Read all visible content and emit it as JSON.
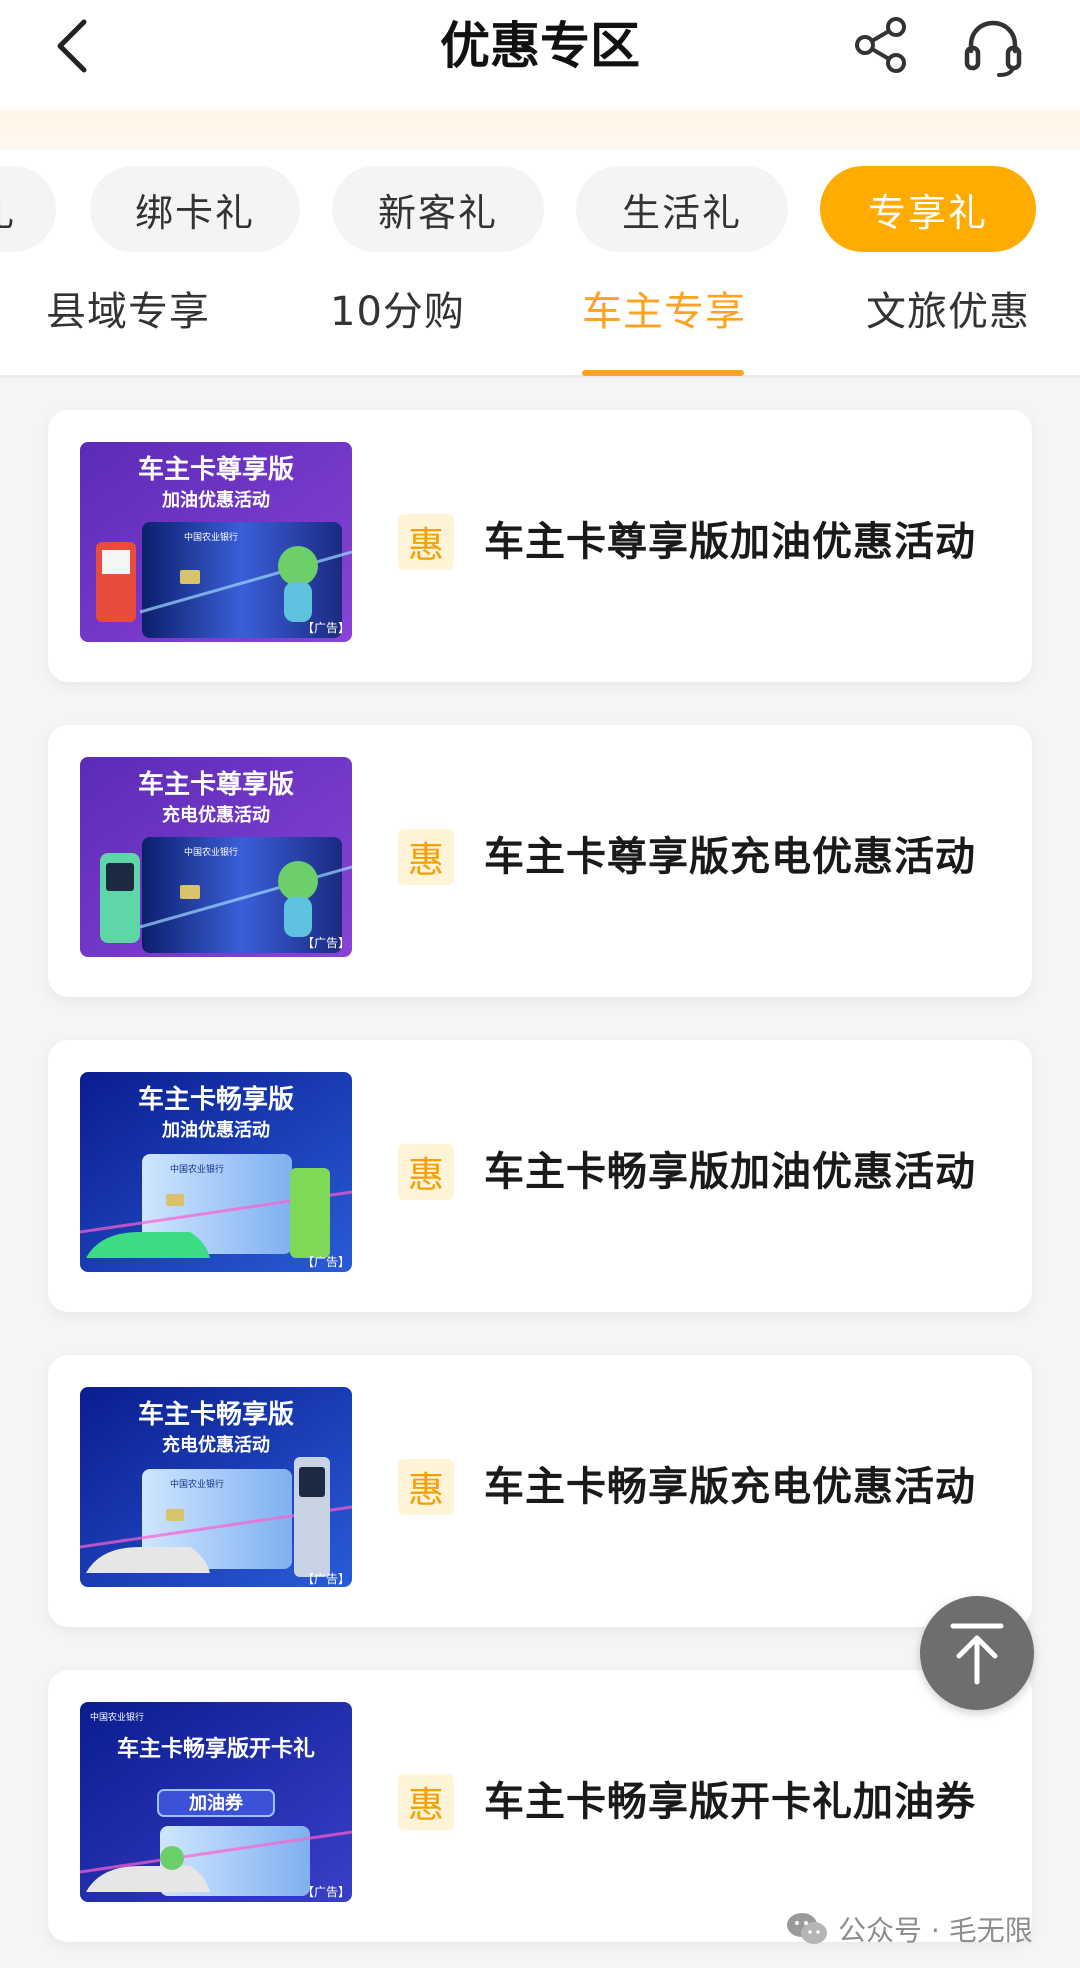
{
  "header": {
    "title": "优惠专区",
    "back_icon": "chevron-left-icon",
    "share_icon": "share-icon",
    "service_icon": "headset-icon"
  },
  "categories": [
    {
      "label": "礼",
      "active": false
    },
    {
      "label": "绑卡礼",
      "active": false
    },
    {
      "label": "新客礼",
      "active": false
    },
    {
      "label": "生活礼",
      "active": false
    },
    {
      "label": "专享礼",
      "active": true
    }
  ],
  "subtabs": [
    {
      "label": "县域专享",
      "active": false
    },
    {
      "label": "10分购",
      "active": false
    },
    {
      "label": "车主专享",
      "active": true
    },
    {
      "label": "文旅优惠",
      "active": false
    }
  ],
  "cards": [
    {
      "badge": "惠",
      "title": "车主卡尊享版加油优惠活动",
      "thumb": {
        "headline": "车主卡尊享版",
        "sub": "加油优惠活动",
        "bank": "中国农业银行",
        "ad": "【广告】",
        "theme": "purple"
      }
    },
    {
      "badge": "惠",
      "title": "车主卡尊享版充电优惠活动",
      "thumb": {
        "headline": "车主卡尊享版",
        "sub": "充电优惠活动",
        "bank": "中国农业银行",
        "ad": "【广告】",
        "theme": "purple"
      }
    },
    {
      "badge": "惠",
      "title": "车主卡畅享版加油优惠活动",
      "thumb": {
        "headline": "车主卡畅享版",
        "sub": "加油优惠活动",
        "bank": "中国农业银行",
        "ad": "【广告】",
        "theme": "blue"
      }
    },
    {
      "badge": "惠",
      "title": "车主卡畅享版充电优惠活动",
      "thumb": {
        "headline": "车主卡畅享版",
        "sub": "充电优惠活动",
        "bank": "中国农业银行",
        "ad": "【广告】",
        "theme": "blue"
      }
    },
    {
      "badge": "惠",
      "title": "车主卡畅享版开卡礼加油券",
      "thumb": {
        "headline": "车主卡畅享版开卡礼",
        "sub": "加油券",
        "bank": "中国农业银行",
        "ad": "【广告】",
        "theme": "blue"
      }
    }
  ],
  "to_top_icon": "arrow-up-icon",
  "watermark": {
    "icon": "wechat-icon",
    "text": "公众号 · 毛无限"
  },
  "colors": {
    "accent": "#ffab00",
    "tab_active": "#ffa21f",
    "badge_bg": "#fff3d8",
    "badge_fg": "#f5a000"
  }
}
